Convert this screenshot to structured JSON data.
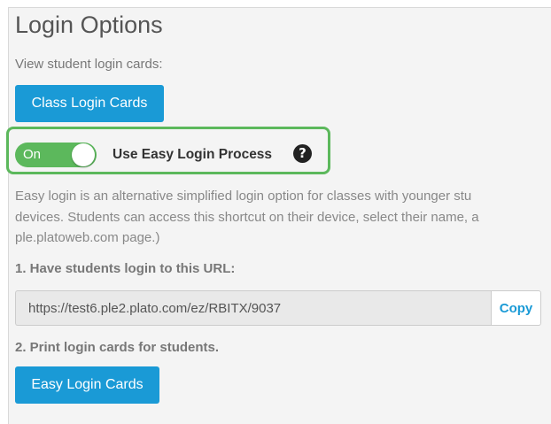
{
  "section": {
    "title": "Login Options",
    "subtitle": "View student login cards:"
  },
  "class_login_button": {
    "label": "Class Login Cards"
  },
  "easy_login_toggle": {
    "state_label": "On",
    "is_on": true,
    "label": "Use Easy Login Process",
    "help_icon_glyph": "?"
  },
  "description": {
    "lines": [
      "Easy login is an alternative simplified login option for classes with younger stu",
      "devices. Students can access this shortcut on their device, select their name, a",
      "ple.platoweb.com page.)"
    ]
  },
  "step1": {
    "label": "1. Have students login to this URL:",
    "url": "https://test6.ple2.plato.com/ez/RBITX/9037",
    "copy_label": "Copy"
  },
  "step2": {
    "label": "2. Print login cards for students."
  },
  "easy_login_button": {
    "label": "Easy Login Cards"
  },
  "colors": {
    "primary_button": "#1a9ad6",
    "toggle_on": "#5cb85c",
    "highlight_border": "#5cb85c"
  }
}
